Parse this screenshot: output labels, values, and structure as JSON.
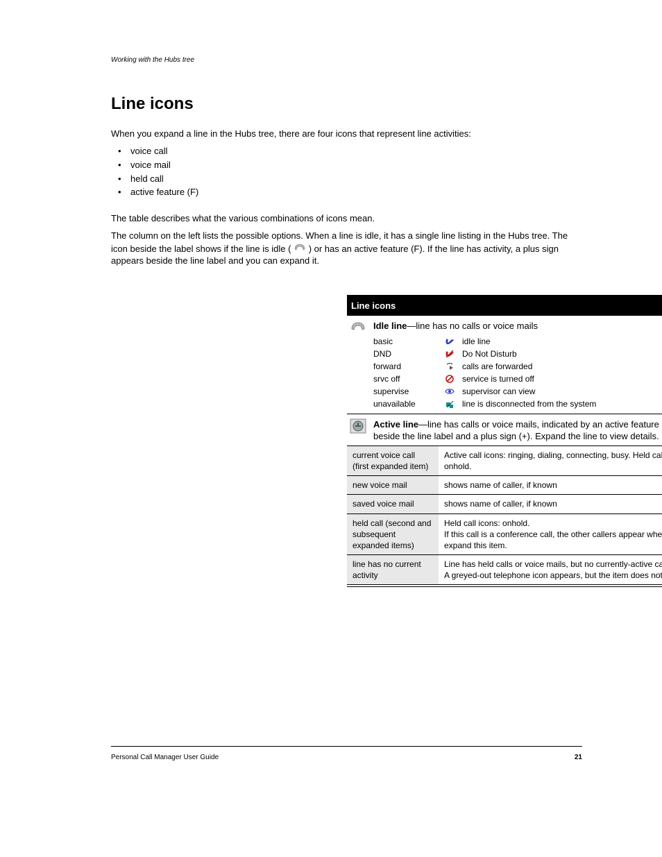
{
  "breadcrumb": "Working with the Hubs tree",
  "heading": "Line icons",
  "intro": {
    "p1": "When you expand a line in the Hubs tree, there are four icons that represent line activities:",
    "items": [
      "voice call",
      "voice mail",
      "held call",
      "active feature (F)"
    ],
    "p2": "The table describes what the various combinations of icons mean.",
    "p3_a": "The column on the left lists the possible options. When a line is idle, it has a single line listing in the Hubs tree. The icon beside the label shows if the line is idle (",
    "p3_b": ") or has an active feature (F). If the line has activity, a plus sign appears beside the line label and you can expand it."
  },
  "table": {
    "title": "Line icons",
    "section_idle": {
      "label": "Idle line",
      "desc": "—line has no calls or voice mails",
      "rows": [
        {
          "l": "basic",
          "r": "idle line"
        },
        {
          "l": "DND",
          "r": "Do Not Disturb"
        },
        {
          "l": "forward",
          "r": "calls are forwarded"
        },
        {
          "l": "srvc off",
          "r": "service is turned off"
        },
        {
          "l": "supervise",
          "r": "supervisor can view"
        },
        {
          "l": "unavailable",
          "r": "line is disconnected from the system"
        }
      ]
    },
    "section_active": {
      "label": "Active line",
      "desc": "—line has calls or voice mails, indicated by an active feature icon (F) beside the line label and a plus sign (+). Expand the line to view details.",
      "rows": [
        {
          "l": "current voice call (first expanded item)",
          "r": "Active call icons: ringing, dialing, connecting, busy. Held call icons: onhold."
        },
        {
          "l": "new voice mail",
          "r": "shows name of caller, if known"
        },
        {
          "l": "saved voice mail",
          "r": "shows name of caller, if known"
        },
        {
          "l": "held call (second and subsequent expanded items)",
          "r": "Held call icons: onhold.\nIf this call is a conference call, the other callers appear when you expand this item."
        },
        {
          "l": "line has no current activity",
          "r": "Line has held calls or voice mails, but no currently-active call.\nA greyed-out telephone icon appears, but the item does not expand."
        }
      ]
    }
  },
  "footer": {
    "left": "Personal Call Manager User Guide",
    "right": "21"
  }
}
